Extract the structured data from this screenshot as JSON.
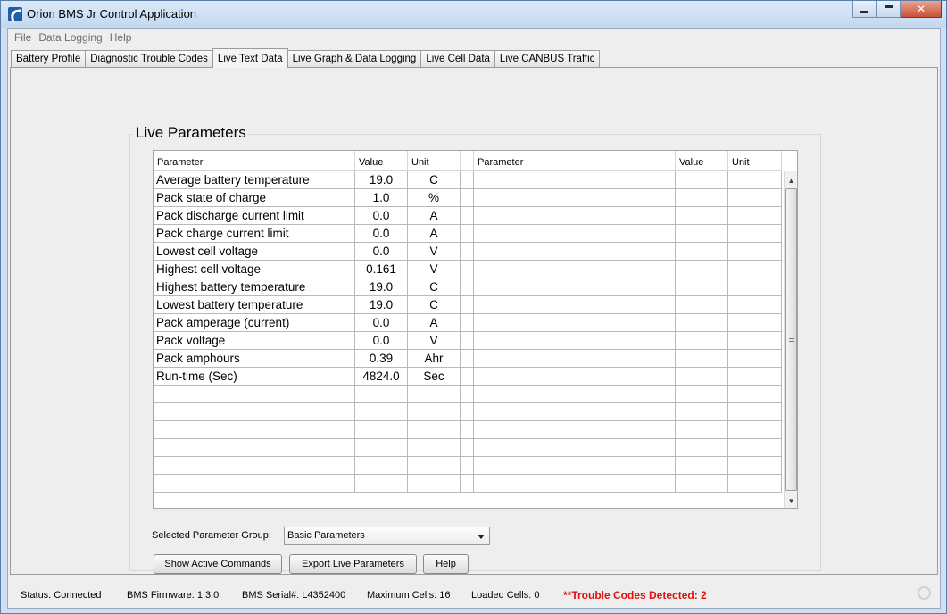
{
  "window": {
    "title": "Orion BMS Jr Control Application"
  },
  "menu": [
    "File",
    "Data Logging",
    "Help"
  ],
  "tabs": [
    {
      "label": "Battery Profile",
      "active": false
    },
    {
      "label": "Diagnostic Trouble Codes",
      "active": false
    },
    {
      "label": "Live Text Data",
      "active": true
    },
    {
      "label": "Live Graph & Data Logging",
      "active": false
    },
    {
      "label": "Live Cell Data",
      "active": false
    },
    {
      "label": "Live CANBUS Traffic",
      "active": false
    }
  ],
  "live_params": {
    "title": "Live Parameters",
    "headers": [
      "Parameter",
      "Value",
      "Unit",
      "",
      "Parameter",
      "Value",
      "Unit"
    ],
    "rows": [
      {
        "param": "Average battery temperature",
        "value": "19.0",
        "unit": "C"
      },
      {
        "param": "Pack state of charge",
        "value": "1.0",
        "unit": "%"
      },
      {
        "param": "Pack discharge current limit",
        "value": "0.0",
        "unit": "A"
      },
      {
        "param": "Pack charge current limit",
        "value": "0.0",
        "unit": "A"
      },
      {
        "param": "Lowest cell voltage",
        "value": "0.0",
        "unit": "V"
      },
      {
        "param": "Highest cell voltage",
        "value": "0.161",
        "unit": "V"
      },
      {
        "param": "Highest battery temperature",
        "value": "19.0",
        "unit": "C"
      },
      {
        "param": "Lowest battery temperature",
        "value": "19.0",
        "unit": "C"
      },
      {
        "param": "Pack amperage (current)",
        "value": "0.0",
        "unit": "A"
      },
      {
        "param": "Pack voltage",
        "value": "0.0",
        "unit": "V"
      },
      {
        "param": "Pack amphours",
        "value": "0.39",
        "unit": "Ahr"
      },
      {
        "param": "Run-time (Sec)",
        "value": "4824.0",
        "unit": "Sec"
      }
    ],
    "empty_rows": 6,
    "group_label": "Selected Parameter Group:",
    "group_value": "Basic Parameters",
    "buttons": {
      "show_active": "Show Active Commands",
      "export": "Export Live Parameters",
      "help": "Help"
    }
  },
  "status": {
    "connection": "Status: Connected",
    "firmware": "BMS Firmware: 1.3.0",
    "serial": "BMS Serial#: L4352400",
    "max_cells": "Maximum Cells: 16",
    "loaded_cells": "Loaded Cells: 0",
    "trouble": "**Trouble Codes Detected: 2",
    "trouble_color": "#e01010"
  }
}
